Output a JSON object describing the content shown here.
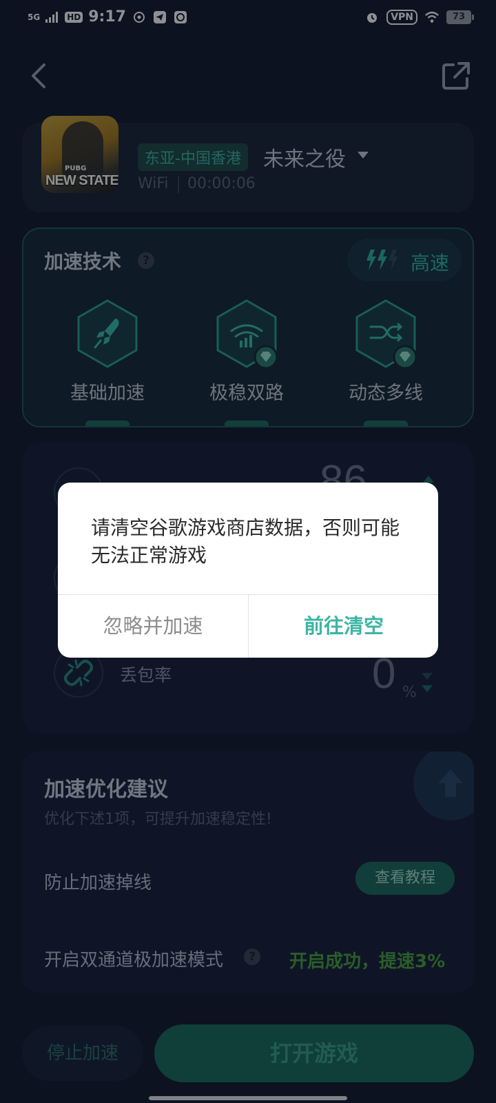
{
  "status_bar": {
    "network": "5G",
    "hd": "HD",
    "time": "9:17",
    "vpn": "VPN",
    "battery": "73"
  },
  "header": {
    "back_icon": "chevron-left-icon",
    "share_icon": "external-link-icon"
  },
  "game": {
    "thumb_title": "NEW STATE",
    "thumb_subtitle": "PUBG",
    "region": "东亚-中国香港",
    "server": "未来之役",
    "network_type": "WiFi",
    "elapsed": "00:00:06"
  },
  "tech": {
    "title": "加速技术",
    "help": "?",
    "speed_label": "高速",
    "features": [
      {
        "label": "基础加速",
        "icon": "rocket-icon"
      },
      {
        "label": "极稳双路",
        "icon": "dual-wifi-icon",
        "premium": true
      },
      {
        "label": "动态多线",
        "icon": "multiline-icon",
        "premium": true
      }
    ]
  },
  "metrics": {
    "latency_value": "86",
    "packet_loss_label": "丢包率",
    "packet_loss_value": "0",
    "packet_loss_unit": "%"
  },
  "advice": {
    "title": "加速优化建议",
    "subtitle": "优化下述1项，可提升加速稳定性!",
    "row1_label": "防止加速掉线",
    "row1_button": "查看教程",
    "row2_label": "开启双通道极加速模式",
    "row2_status": "开启成功，提速3%"
  },
  "bottom": {
    "stop_label": "停止加速",
    "open_label": "打开游戏"
  },
  "dialog": {
    "message": "请清空谷歌游戏商店数据，否则可能无法正常游戏",
    "ignore_label": "忽略并加速",
    "confirm_label": "前往清空"
  },
  "colors": {
    "background": "#131a2c",
    "accent": "#3cb5a3",
    "success": "#4aa23c"
  }
}
